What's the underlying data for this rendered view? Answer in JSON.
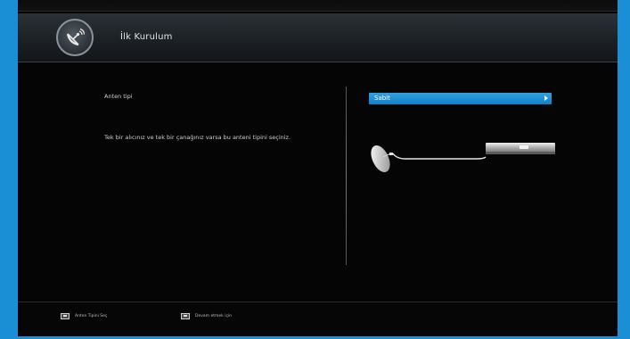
{
  "header": {
    "title": "İlk Kurulum",
    "icon": "satellite-dish-icon"
  },
  "main": {
    "antenna_type_label": "Anten tipi",
    "description": "Tek bir alıcınız ve tek bir çanağınız varsa bu anteni tipini seçiniz.",
    "antenna_type_select": {
      "value": "Sabit"
    }
  },
  "footer": {
    "hints": [
      {
        "icon": "keyboard-key-icon",
        "label": "Anten Tipini Seç"
      },
      {
        "icon": "keyboard-key-icon",
        "label": "Devam etmek için"
      }
    ]
  },
  "colors": {
    "accent": "#1a8fd6",
    "select_bg": "#1f8fd4",
    "background": "#050505"
  }
}
